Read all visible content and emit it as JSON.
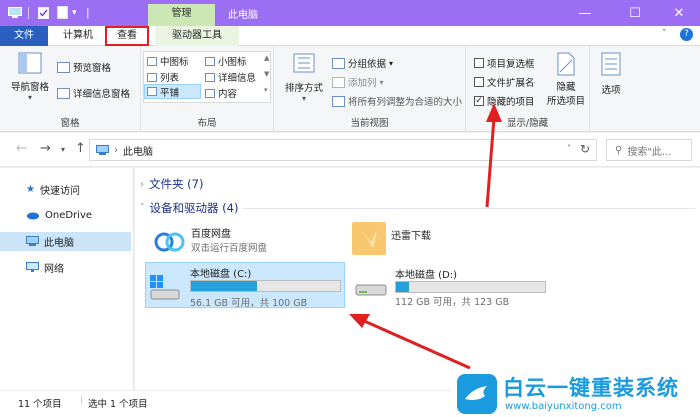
{
  "titlebar": {
    "manage_tab": "管理",
    "title": "此电脑",
    "color": "#9b6ef3"
  },
  "tabs": {
    "file": "文件",
    "computer": "计算机",
    "view": "查看",
    "drive_tools": "驱动器工具"
  },
  "ribbon": {
    "panes": {
      "nav_pane": "导航窗格",
      "preview_pane": "预览窗格",
      "details_pane": "详细信息窗格",
      "label": "窗格"
    },
    "layout": {
      "medium_icons": "中图标",
      "small_icons": "小图标",
      "list": "列表",
      "details": "详细信息",
      "tiles": "平铺",
      "content": "内容",
      "label": "布局"
    },
    "current_view": {
      "sort_by": "排序方式",
      "group_by": "分组依据",
      "add_columns": "添加列",
      "size_all_columns": "将所有列调整为合适的大小",
      "label": "当前视图"
    },
    "show_hide": {
      "item_checkboxes": "项目复选框",
      "file_extensions": "文件扩展名",
      "hidden_items": "隐藏的项目",
      "hidden_items_checked": true,
      "hide_selected": "隐藏",
      "hide_selected_2": "所选项目",
      "label": "显示/隐藏"
    },
    "options": "选项"
  },
  "address": {
    "path": "此电脑",
    "search_placeholder": "搜索\"此..."
  },
  "sidebar": {
    "items": [
      "快速访问",
      "OneDrive",
      "此电脑",
      "网络"
    ]
  },
  "content": {
    "folders_group": "文件夹 (7)",
    "devices_group": "设备和驱动器 (4)",
    "entries": [
      {
        "name": "百度网盘",
        "sub": "双击运行百度网盘"
      },
      {
        "name": "迅雷下载",
        "sub": ""
      }
    ],
    "drives": [
      {
        "name": "本地磁盘 (C:)",
        "free": "56.1 GB 可用，共 100 GB",
        "used_fraction": 0.44
      },
      {
        "name": "本地磁盘 (D:)",
        "free": "112 GB 可用，共 123 GB",
        "used_fraction": 0.09
      }
    ]
  },
  "status": {
    "count": "11 个项目",
    "selected": "选中 1 个项目"
  },
  "watermark": {
    "brand": "白云一键重装系统",
    "url": "www.baiyunxitong.com"
  },
  "colors": {
    "accent": "#26a0da",
    "selection": "#cce8ff",
    "arrow": "#e02020",
    "watermark": "#1a9be0"
  }
}
